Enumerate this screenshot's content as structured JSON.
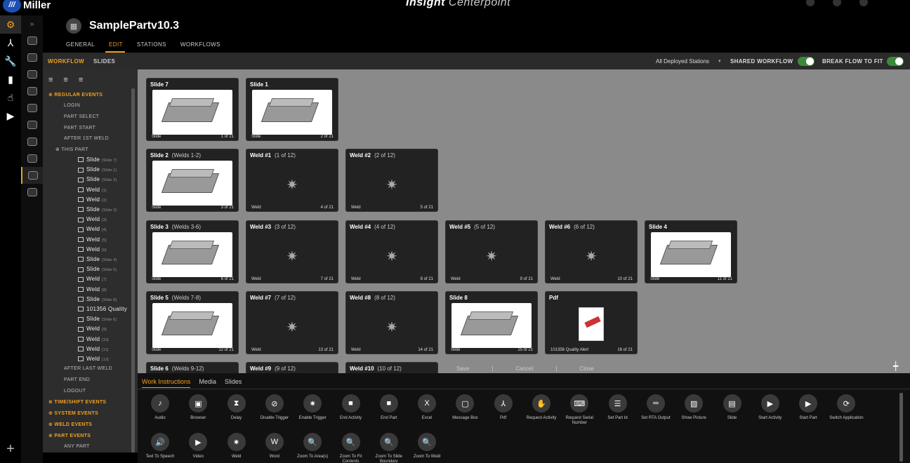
{
  "app": {
    "logo_mark": "///",
    "logo_text": "Miller",
    "brand_bold": "Insight",
    "brand_light": "Centerpoint"
  },
  "rail": {
    "icons": [
      "gear-icon",
      "workflow-icon",
      "wrench-icon",
      "bar-chart-icon",
      "touch-icon",
      "play-icon"
    ],
    "plus": "+"
  },
  "header": {
    "title": "SamplePartv10.3",
    "tabs": [
      "GENERAL",
      "EDIT",
      "STATIONS",
      "WORKFLOWS"
    ],
    "active_tab": "EDIT"
  },
  "subbar": {
    "workflow": "WORKFLOW",
    "slides": "SLIDES",
    "stations_select": "All Deployed Stations",
    "shared_workflow": "SHARED WORKFLOW",
    "break_flow": "BREAK FLOW TO FIT"
  },
  "events": {
    "regular": "REGULAR EVENTS",
    "login": "LOGIN",
    "part_select": "PART SELECT",
    "part_start": "PART START",
    "after_first_weld": "AFTER 1ST WELD",
    "this_part": "THIS PART",
    "items": [
      {
        "label": "Slide",
        "tag": "[Slide 7]"
      },
      {
        "label": "Slide",
        "tag": "[Slide 1]"
      },
      {
        "label": "Slide",
        "tag": "[Slide 2]"
      },
      {
        "label": "Weld",
        "tag": "[1]"
      },
      {
        "label": "Weld",
        "tag": "[2]"
      },
      {
        "label": "Slide",
        "tag": "[Slide 3]"
      },
      {
        "label": "Weld",
        "tag": "[3]"
      },
      {
        "label": "Weld",
        "tag": "[4]"
      },
      {
        "label": "Weld",
        "tag": "[5]"
      },
      {
        "label": "Weld",
        "tag": "[6]"
      },
      {
        "label": "Slide",
        "tag": "[Slide 4]"
      },
      {
        "label": "Slide",
        "tag": "[Slide 5]"
      },
      {
        "label": "Weld",
        "tag": "[7]"
      },
      {
        "label": "Weld",
        "tag": "[8]"
      },
      {
        "label": "Slide",
        "tag": "[Slide 8]"
      },
      {
        "label": "101356 Quality",
        "tag": ""
      },
      {
        "label": "Slide",
        "tag": "[Slide 6]"
      },
      {
        "label": "Weld",
        "tag": "[9]"
      },
      {
        "label": "Weld",
        "tag": "[10]"
      },
      {
        "label": "Weld",
        "tag": "[11]"
      },
      {
        "label": "Weld",
        "tag": "[12]"
      }
    ],
    "after_last_weld": "AFTER LAST WELD",
    "part_end": "PART END",
    "logout": "LOGOUT",
    "time_shift": "TIME/SHIFT EVENTS",
    "system": "SYSTEM EVENTS",
    "weld": "WELD EVENTS",
    "part_events": "PART EVENTS",
    "any_part": "ANY PART"
  },
  "cards": [
    {
      "title": "Slide 7",
      "sub": "",
      "kind": "slide",
      "foot": "Slide",
      "count": "1 of 21"
    },
    {
      "title": "Slide 1",
      "sub": "",
      "kind": "slide",
      "foot": "Slide",
      "count": "2 of 21"
    },
    {
      "title": "Slide 2",
      "sub": "(Welds 1-2)",
      "kind": "slide",
      "foot": "Slide",
      "count": "3 of 21"
    },
    {
      "title": "Weld #1",
      "sub": "(1 of 12)",
      "kind": "weld",
      "foot": "Weld",
      "count": "4 of 21"
    },
    {
      "title": "Weld #2",
      "sub": "(2 of 12)",
      "kind": "weld",
      "foot": "Weld",
      "count": "5 of 21"
    },
    {
      "title": "Slide 3",
      "sub": "(Welds 3-6)",
      "kind": "slide",
      "foot": "Slide",
      "count": "6 of 21"
    },
    {
      "title": "Weld #3",
      "sub": "(3 of 12)",
      "kind": "weld",
      "foot": "Weld",
      "count": "7 of 21"
    },
    {
      "title": "Weld #4",
      "sub": "(4 of 12)",
      "kind": "weld",
      "foot": "Weld",
      "count": "8 of 21"
    },
    {
      "title": "Weld #5",
      "sub": "(5 of 12)",
      "kind": "weld",
      "foot": "Weld",
      "count": "9 of 21"
    },
    {
      "title": "Weld #6",
      "sub": "(6 of 12)",
      "kind": "weld",
      "foot": "Weld",
      "count": "10 of 21"
    },
    {
      "title": "Slide 4",
      "sub": "",
      "kind": "slide",
      "foot": "Slide",
      "count": "11 of 21"
    },
    {
      "title": "Slide 5",
      "sub": "(Welds 7-8)",
      "kind": "slide",
      "foot": "Slide",
      "count": "12 of 21"
    },
    {
      "title": "Weld #7",
      "sub": "(7 of 12)",
      "kind": "weld",
      "foot": "Weld",
      "count": "13 of 21"
    },
    {
      "title": "Weld #8",
      "sub": "(8 of 12)",
      "kind": "weld",
      "foot": "Weld",
      "count": "14 of 21"
    },
    {
      "title": "Slide 8",
      "sub": "",
      "kind": "slide",
      "foot": "Slide",
      "count": "15 of 21"
    },
    {
      "title": "Pdf",
      "sub": "",
      "kind": "pdf",
      "foot": "101356 Quality Alert",
      "count": "16 of 21"
    },
    {
      "title": "Slide 6",
      "sub": "(Welds 9-12)",
      "kind": "slide",
      "foot": "",
      "count": ""
    },
    {
      "title": "Weld #9",
      "sub": "(9 of 12)",
      "kind": "weld",
      "foot": "",
      "count": ""
    },
    {
      "title": "Weld #10",
      "sub": "(10 of 12)",
      "kind": "weld",
      "foot": "",
      "count": ""
    }
  ],
  "actions": {
    "save": "Save",
    "cancel": "Cancel",
    "close": "Close"
  },
  "palette": {
    "tabs": [
      "Work Instructions",
      "Media",
      "Slides"
    ],
    "tools": [
      {
        "label": "Audio",
        "icon": "audio-icon",
        "glyph": "♪"
      },
      {
        "label": "Browser",
        "icon": "browser-icon",
        "glyph": "▣"
      },
      {
        "label": "Delay",
        "icon": "hourglass-icon",
        "glyph": "⧗"
      },
      {
        "label": "Disable Trigger",
        "icon": "disable-icon",
        "glyph": "⊘"
      },
      {
        "label": "Enable Trigger",
        "icon": "trigger-icon",
        "glyph": "✷"
      },
      {
        "label": "End Activity",
        "icon": "stop-icon",
        "glyph": "■"
      },
      {
        "label": "End Part",
        "icon": "stop-icon",
        "glyph": "■"
      },
      {
        "label": "Excel",
        "icon": "excel-icon",
        "glyph": "X"
      },
      {
        "label": "Message Box",
        "icon": "message-icon",
        "glyph": "▢"
      },
      {
        "label": "Pdf",
        "icon": "pdf-icon",
        "glyph": "⅄"
      },
      {
        "label": "Request Activity",
        "icon": "request-icon",
        "glyph": "✋"
      },
      {
        "label": "Request Serial Number",
        "icon": "keyboard-icon",
        "glyph": "⌨"
      },
      {
        "label": "Set Part Id",
        "icon": "list-icon",
        "glyph": "☰"
      },
      {
        "label": "Set RTA Output",
        "icon": "output-icon",
        "glyph": "═"
      },
      {
        "label": "Show Picture",
        "icon": "picture-icon",
        "glyph": "▨"
      },
      {
        "label": "Slide",
        "icon": "slide-icon",
        "glyph": "▤"
      },
      {
        "label": "Start Activity",
        "icon": "play-icon",
        "glyph": "▶"
      },
      {
        "label": "Start Part",
        "icon": "play-icon",
        "glyph": "▶"
      },
      {
        "label": "Switch Application",
        "icon": "switch-icon",
        "glyph": "⟳"
      },
      {
        "label": "Text To Speech",
        "icon": "speaker-icon",
        "glyph": "🔊"
      },
      {
        "label": "Video",
        "icon": "video-icon",
        "glyph": "▶"
      },
      {
        "label": "Weld",
        "icon": "weld-icon",
        "glyph": "✷"
      },
      {
        "label": "Word",
        "icon": "word-icon",
        "glyph": "W"
      },
      {
        "label": "Zoom To Area(s)",
        "icon": "zoom-icon",
        "glyph": "🔍"
      },
      {
        "label": "Zoom To Fit Contents",
        "icon": "zoom-icon",
        "glyph": "🔍"
      },
      {
        "label": "Zoom To Slide Boundary",
        "icon": "zoom-icon",
        "glyph": "🔍"
      },
      {
        "label": "Zoom To Weld",
        "icon": "zoom-icon",
        "glyph": "🔍"
      }
    ]
  }
}
